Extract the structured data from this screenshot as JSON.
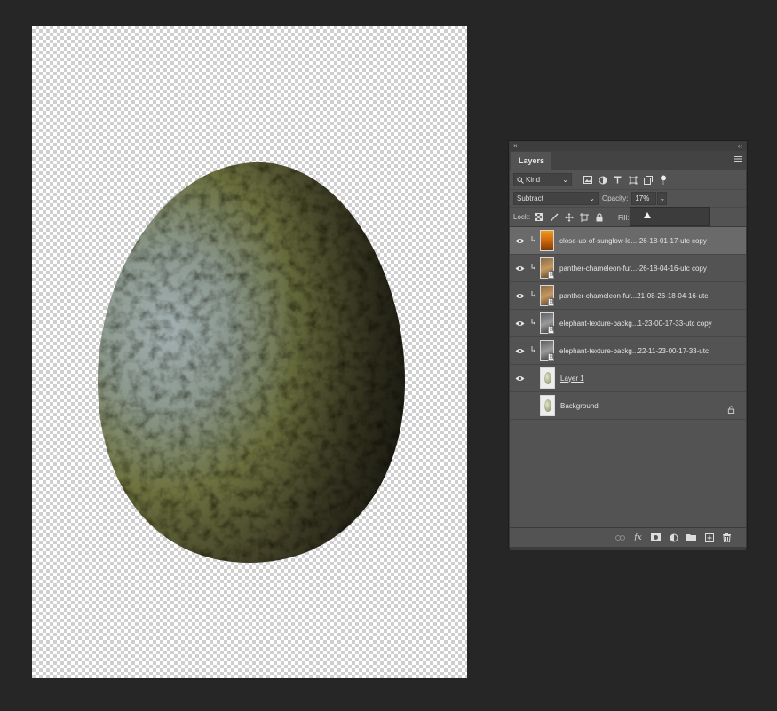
{
  "panel": {
    "close_glyph": "×",
    "collapse_glyph": "‹‹",
    "tab_label": "Layers",
    "menu_icon": "panel-menu-icon"
  },
  "filter": {
    "kind_label": "Kind",
    "icons": [
      "image-filter-icon",
      "adjustment-filter-icon",
      "type-filter-icon",
      "shape-filter-icon",
      "smart-object-filter-icon",
      "filter-toggle-icon"
    ]
  },
  "blend": {
    "mode": "Subtract",
    "opacity_label": "Opacity:",
    "opacity_value": "17%"
  },
  "lock": {
    "label": "Lock:",
    "icons": [
      "lock-transparent-icon",
      "lock-image-icon",
      "lock-position-icon",
      "lock-artboard-icon",
      "lock-all-icon"
    ],
    "fill_label": "Fill:"
  },
  "opacity_slider": {
    "level": 0.17
  },
  "layers": [
    {
      "name": "close-up-of-sunglow-le...-26-18-01-17-utc copy",
      "visible": true,
      "clipped": true,
      "thumb": "orange",
      "selected": true,
      "linked": false
    },
    {
      "name": "panther-chameleon-fur...-26-18-04-16-utc copy",
      "visible": true,
      "clipped": true,
      "thumb": "chameleon",
      "selected": false,
      "linked": true
    },
    {
      "name": "panther-chameleon-fur...21-08-26-18-04-16-utc",
      "visible": true,
      "clipped": true,
      "thumb": "chameleon",
      "selected": false,
      "linked": true
    },
    {
      "name": "elephant-texture-backg...1-23-00-17-33-utc copy",
      "visible": true,
      "clipped": true,
      "thumb": "elephant",
      "selected": false,
      "linked": true
    },
    {
      "name": "elephant-texture-backg...22-11-23-00-17-33-utc",
      "visible": true,
      "clipped": true,
      "thumb": "elephant",
      "selected": false,
      "linked": true
    },
    {
      "name": "Layer 1",
      "visible": true,
      "clipped": false,
      "thumb": "egg",
      "selected": false,
      "linked": false,
      "underline": true
    },
    {
      "name": "Background",
      "visible": false,
      "clipped": false,
      "thumb": "egg",
      "selected": false,
      "linked": false,
      "locked": true
    }
  ],
  "bottom_bar": {
    "icons": [
      "link-layers-icon",
      "fx-icon",
      "add-mask-icon",
      "adjustment-layer-icon",
      "new-group-icon",
      "new-layer-icon",
      "delete-layer-icon"
    ],
    "fx_label": "fx"
  },
  "colors": {
    "app_bg": "#262626",
    "panel_bg": "#535353",
    "selected_row": "#6a6a6a"
  }
}
